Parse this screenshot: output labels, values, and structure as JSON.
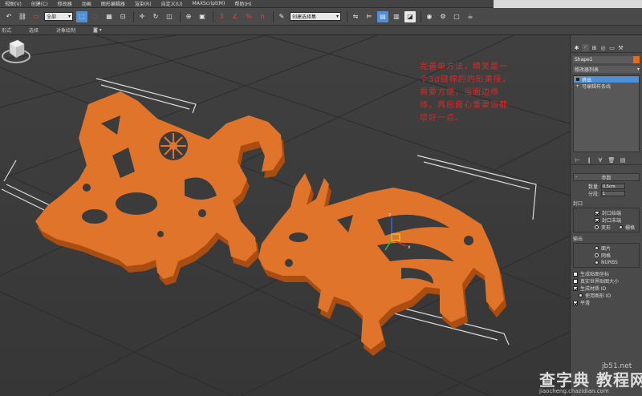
{
  "menubar": {
    "items": [
      "视图(V)",
      "创建(C)",
      "修改器",
      "动画",
      "图形编辑器",
      "渲染(R)",
      "自定义(U)",
      "MAXScript(M)",
      "帮助(H)"
    ]
  },
  "toolbar": {
    "selection_filter": "全部",
    "named_selection_placeholder": "创建选择集",
    "snap_percent": "%",
    "snap_number": "3",
    "spinner_snap_number": "n"
  },
  "ribbon": {
    "labels": [
      "形式",
      "选择",
      "对象绘制"
    ]
  },
  "viewport": {
    "annotation": "完善单方法，睛笑是一个3d键棉的的形果接，需要方便，当面边缘缘，再后面心重要诣都增好一点。"
  },
  "command_panel": {
    "object_name": "Shape1",
    "object_color": "#e06c1c",
    "modifier_list": "修改器列表",
    "stack": [
      "挤出",
      "可编辑样条线"
    ],
    "rollout_title": "参数",
    "amount_label": "数量:",
    "amount_value": "0.5cm",
    "segments_label": "分段:",
    "segments_value": "1",
    "capping_label": "封口",
    "cap_start": "封口始端",
    "cap_end": "封口末端",
    "morph": "变形",
    "grid": "栅格",
    "output_label": "输出",
    "output_patch": "面片",
    "output_mesh": "网格",
    "output_nurbs": "NURBS",
    "gen_mapping": "生成贴图坐标",
    "real_world": "真实世界贴图大小",
    "gen_material_id": "生成材质 ID",
    "use_shape_id": "使用图形 ID",
    "smooth": "平滑"
  },
  "watermark": {
    "big": "查字典 教程网",
    "url": "jb51.net",
    "sub": "jiaocheng.chazidian.com"
  }
}
